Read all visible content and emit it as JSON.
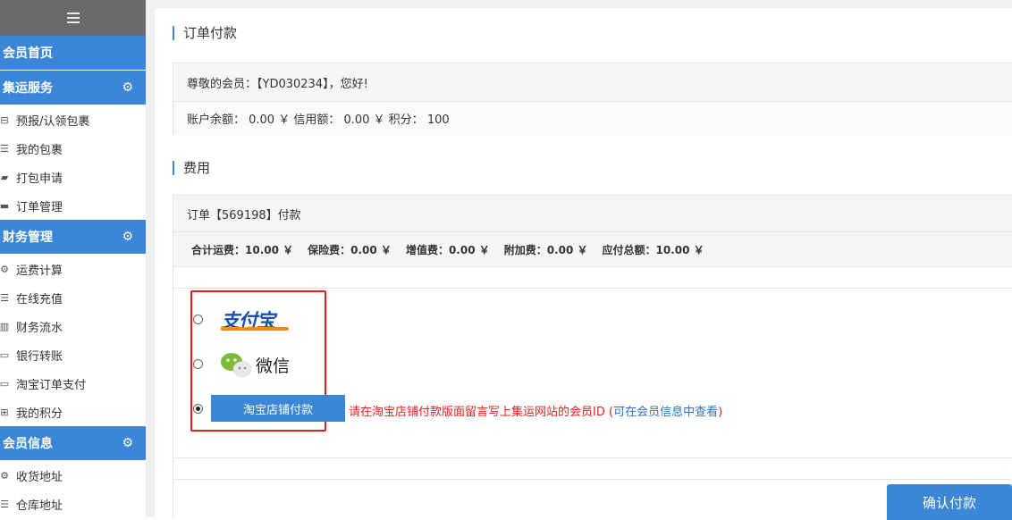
{
  "sidebar": {
    "groups": [
      {
        "label": "会员首页",
        "gear": false
      },
      {
        "label": "集运服务",
        "gear": true,
        "items": [
          {
            "icon": "package-icon",
            "glyph": "⊟",
            "label": "预报/认领包裹"
          },
          {
            "icon": "list-icon",
            "glyph": "☰",
            "label": "我的包裹"
          },
          {
            "icon": "truck-icon",
            "glyph": "▰",
            "label": "打包申请"
          },
          {
            "icon": "book-icon",
            "glyph": "▬",
            "label": "订单管理"
          }
        ]
      },
      {
        "label": "财务管理",
        "gear": true,
        "items": [
          {
            "icon": "gears-icon",
            "glyph": "⚙",
            "label": "运费计算"
          },
          {
            "icon": "list-icon",
            "glyph": "☰",
            "label": "在线充值"
          },
          {
            "icon": "bar-chart-icon",
            "glyph": "▥",
            "label": "财务流水"
          },
          {
            "icon": "credit-card-icon",
            "glyph": "▭",
            "label": "银行转账"
          },
          {
            "icon": "card-icon",
            "glyph": "▭",
            "label": "淘宝订单支付"
          },
          {
            "icon": "gift-icon",
            "glyph": "⊞",
            "label": "我的积分"
          }
        ]
      },
      {
        "label": "会员信息",
        "gear": true,
        "items": [
          {
            "icon": "gears-icon",
            "glyph": "⚙",
            "label": "收货地址"
          },
          {
            "icon": "list-icon",
            "glyph": "☰",
            "label": "仓库地址"
          }
        ]
      }
    ]
  },
  "order_section": {
    "title": "订单付款",
    "greeting": "尊敬的会员：【YD030234】，您好!",
    "account": "账户余额： 0.00 ￥   信用额： 0.00 ￥   积分： 100"
  },
  "fee_section": {
    "title": "费用",
    "order_line": "订单【569198】付款",
    "fees": [
      "合计运费：10.00 ￥",
      "保险费：0.00 ￥",
      "增值费：0.00 ￥",
      "附加费：0.00 ￥",
      "应付总额：10.00 ￥"
    ]
  },
  "payment": {
    "alipay_label": "支付宝",
    "wechat_label": "微信",
    "taobao_button": "淘宝店铺付款",
    "hint_prefix": "请在淘宝店铺付款版面留言写上集运网站的会员ID (",
    "hint_link": "可在会员信息中查看",
    "hint_suffix": ")",
    "selected": "taobao"
  },
  "confirm_button": "确认付款",
  "colors": {
    "accent": "#3b86d6",
    "highlight": "#e21f1f",
    "alipay_blue": "#1b4fa8",
    "alipay_orange": "#f08b1f",
    "wechat_green": "#7cbb38"
  }
}
